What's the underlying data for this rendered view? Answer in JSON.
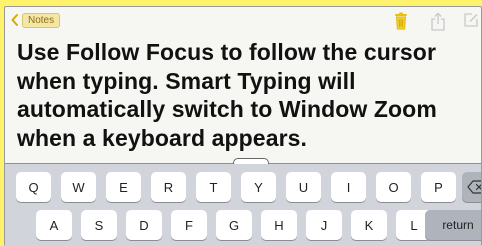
{
  "toolbar": {
    "back_label": "Notes",
    "icons": [
      "trash-icon",
      "share-icon",
      "compose-icon"
    ],
    "accent_color": "#e2b500"
  },
  "note": {
    "text": "Use Follow Focus to follow the cursor when typing.  Smart Typing will automatically switch to Window Zoom when a keyboard appears."
  },
  "keyboard": {
    "row1": [
      "Q",
      "W",
      "E",
      "R",
      "T",
      "Y",
      "U",
      "I",
      "O",
      "P"
    ],
    "row2": [
      "A",
      "S",
      "D",
      "F",
      "G",
      "H",
      "J",
      "K",
      "L"
    ],
    "return_label": "return",
    "delete_icon": "backspace-icon"
  },
  "colors": {
    "background": "#fef36a",
    "note_bg": "#f6f6f3",
    "keyboard_bg": "#d1d4da"
  }
}
